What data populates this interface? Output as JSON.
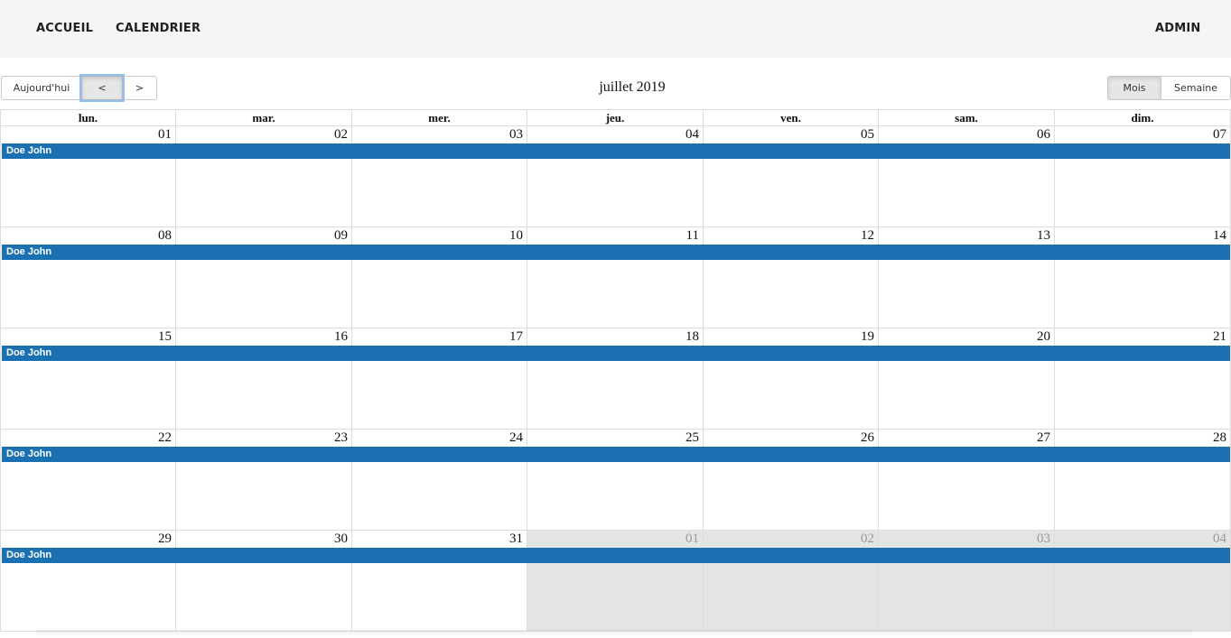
{
  "navbar": {
    "home_label": "ACCUEIL",
    "calendar_label": "CALENDRIER",
    "admin_label": "ADMIN"
  },
  "toolbar": {
    "today_label": "Aujourd'hui",
    "prev_label": "<",
    "next_label": ">",
    "title": "juillet 2019",
    "month_label": "Mois",
    "week_label": "Semaine",
    "active_view": "Mois"
  },
  "calendar": {
    "weekdays": [
      "lun.",
      "mar.",
      "mer.",
      "jeu.",
      "ven.",
      "sam.",
      "dim."
    ],
    "weeks": [
      {
        "days": [
          {
            "num": "01",
            "other": false
          },
          {
            "num": "02",
            "other": false
          },
          {
            "num": "03",
            "other": false
          },
          {
            "num": "04",
            "other": false
          },
          {
            "num": "05",
            "other": false
          },
          {
            "num": "06",
            "other": false
          },
          {
            "num": "07",
            "other": false
          }
        ],
        "event": "Doe John"
      },
      {
        "days": [
          {
            "num": "08",
            "other": false
          },
          {
            "num": "09",
            "other": false
          },
          {
            "num": "10",
            "other": false
          },
          {
            "num": "11",
            "other": false
          },
          {
            "num": "12",
            "other": false
          },
          {
            "num": "13",
            "other": false
          },
          {
            "num": "14",
            "other": false
          }
        ],
        "event": "Doe John"
      },
      {
        "days": [
          {
            "num": "15",
            "other": false
          },
          {
            "num": "16",
            "other": false
          },
          {
            "num": "17",
            "other": false
          },
          {
            "num": "18",
            "other": false
          },
          {
            "num": "19",
            "other": false
          },
          {
            "num": "20",
            "other": false
          },
          {
            "num": "21",
            "other": false
          }
        ],
        "event": "Doe John"
      },
      {
        "days": [
          {
            "num": "22",
            "other": false
          },
          {
            "num": "23",
            "other": false
          },
          {
            "num": "24",
            "other": false
          },
          {
            "num": "25",
            "other": false
          },
          {
            "num": "26",
            "other": false
          },
          {
            "num": "27",
            "other": false
          },
          {
            "num": "28",
            "other": false
          }
        ],
        "event": "Doe John"
      },
      {
        "days": [
          {
            "num": "29",
            "other": false
          },
          {
            "num": "30",
            "other": false
          },
          {
            "num": "31",
            "other": false
          },
          {
            "num": "01",
            "other": true
          },
          {
            "num": "02",
            "other": true
          },
          {
            "num": "03",
            "other": true
          },
          {
            "num": "04",
            "other": true
          }
        ],
        "event": "Doe John"
      }
    ]
  },
  "colors": {
    "event": "#1a70b0",
    "navbar_bg": "#f5f5f5",
    "other_month_bg": "#e4e4e4",
    "grid_border": "#dddddd"
  }
}
